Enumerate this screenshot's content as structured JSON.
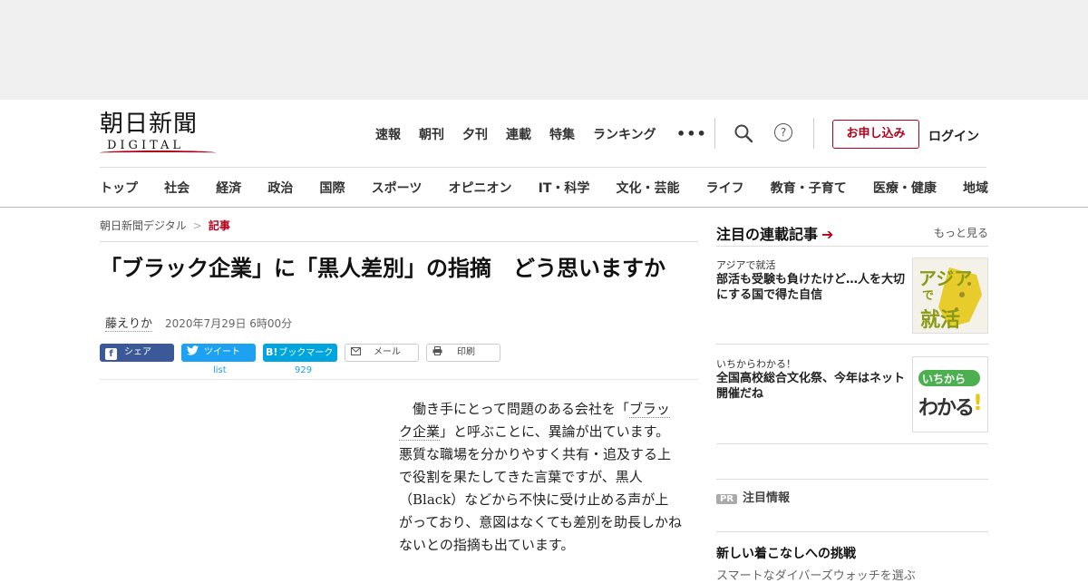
{
  "header": {
    "logo_main": "朝日新聞",
    "logo_sub": "DIGITAL",
    "top_nav": [
      "速報",
      "朝刊",
      "夕刊",
      "連載",
      "特集",
      "ランキング"
    ],
    "more": "•••",
    "help": "?",
    "apply": "お申し込み",
    "login": "ログイン"
  },
  "categories": [
    "トップ",
    "社会",
    "経済",
    "政治",
    "国際",
    "スポーツ",
    "オピニオン",
    "IT・科学",
    "文化・芸能",
    "ライフ",
    "教育・子育て",
    "医療・健康",
    "地域"
  ],
  "breadcrumb": {
    "home": "朝日新聞デジタル",
    "sep": ">",
    "current": "記事"
  },
  "article": {
    "title": "「ブラック企業」に「黒人差別」の指摘　どう思いますか",
    "author": "藤えりか",
    "date": "2020年7月29日 6時00分",
    "share": {
      "facebook": "シェア",
      "twitter": "ツイート",
      "twitter_count": "list",
      "hatena": "ブックマーク",
      "hatena_icon": "B!",
      "hatena_count": "929",
      "mail": "メール",
      "print": "印刷"
    },
    "body_before": "働き手にとって問題のある会社を「",
    "body_keyword": "ブラック企業",
    "body_after": "」と呼ぶことに、異論が出ています。悪質な職場を分かりやすく共有・追及する上で役割を果たしてきた言葉ですが、黒人（Black）などから不快に受け止める声が上がっており、意図はなくても差別を助長しかねないとの指摘も出ています。"
  },
  "sidebar": {
    "heading": "注目の連載記事",
    "arrow": "➔",
    "more": "もっと見る",
    "cards": [
      {
        "tag": "アジアで就活",
        "title": "部活も受験も負けたけど…人を大切にする国で得た自信",
        "thumb_text_1": "アジア",
        "thumb_text_2": "で",
        "thumb_text_3": "就活"
      },
      {
        "tag": "いちからわかる！",
        "title": "全国高校総合文化祭、今年はネット開催だね",
        "thumb_text_1": "いちから",
        "thumb_text_2": "わかる",
        "thumb_text_3": "!"
      }
    ],
    "pr_badge": "PR",
    "pr_label": "注目情報",
    "next_title": "新しい着こなしへの挑戦",
    "next_sub": "スマートなダイバーズウォッチを選ぶ"
  },
  "colors": {
    "accent": "#b3001b",
    "facebook": "#3b5998",
    "twitter": "#1da1f2",
    "hatena": "#00a4de"
  }
}
